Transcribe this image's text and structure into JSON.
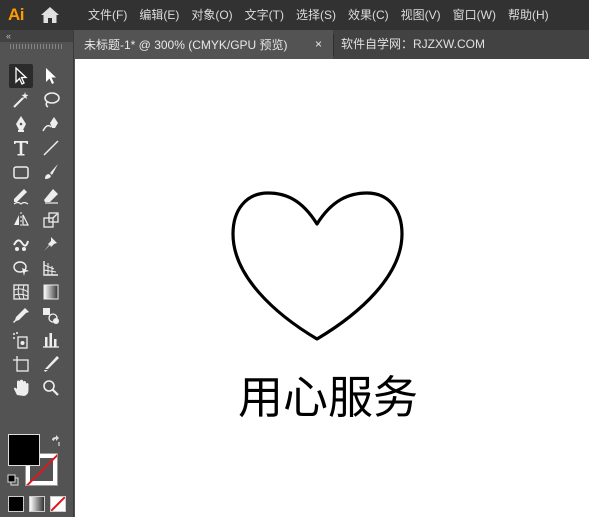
{
  "app": {
    "logo": "Ai"
  },
  "menu": {
    "items": [
      "文件(F)",
      "编辑(E)",
      "对象(O)",
      "文字(T)",
      "选择(S)",
      "效果(C)",
      "视图(V)",
      "窗口(W)",
      "帮助(H)"
    ]
  },
  "tabs": {
    "active_label": "未标题-1* @ 300% (CMYK/GPU 预览)",
    "close_glyph": "×",
    "site_label": "软件自学网：RJZXW.COM"
  },
  "toolbar": {
    "collapse_glyph": "«",
    "tools": [
      [
        "selection-tool",
        "direct-selection-tool"
      ],
      [
        "magic-wand-tool",
        "lasso-tool"
      ],
      [
        "pen-tool",
        "curvature-tool"
      ],
      [
        "type-tool",
        "line-segment-tool"
      ],
      [
        "rectangle-tool",
        "paintbrush-tool"
      ],
      [
        "shaper-tool",
        "eraser-tool"
      ],
      [
        "reflect-tool",
        "scale-tool"
      ],
      [
        "puppet-warp-tool",
        "pin-tool"
      ],
      [
        "shape-builder-tool",
        "perspective-grid-tool"
      ],
      [
        "mesh-tool",
        "gradient-tool"
      ],
      [
        "eyedropper-tool",
        "blend-tool"
      ],
      [
        "symbol-sprayer-tool",
        "column-graph-tool"
      ],
      [
        "artboard-tool",
        "slice-tool"
      ],
      [
        "hand-tool",
        "zoom-tool"
      ]
    ],
    "fill_color": "#000000",
    "stroke": "none"
  },
  "canvas": {
    "text": "用心服务",
    "shape": "heart-outline",
    "background": "#ffffff"
  },
  "colors": {
    "menubar_bg": "#323232",
    "panel_bg": "#535353",
    "logo": "#ff9a00",
    "none_slash": "#e0161d"
  }
}
